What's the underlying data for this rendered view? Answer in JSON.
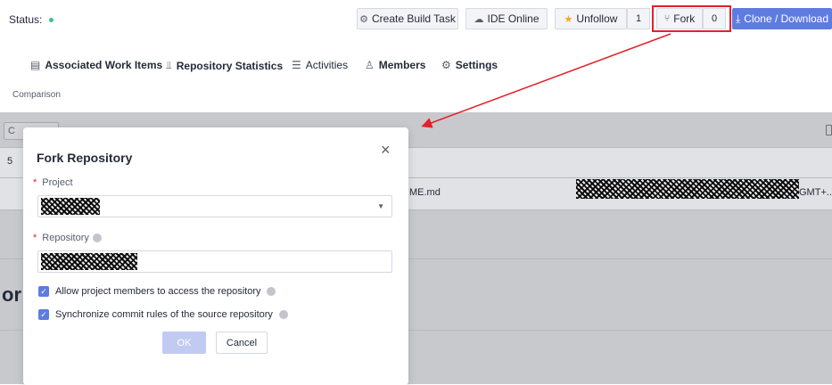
{
  "header": {
    "status_label": "Status:",
    "create_build_task": "Create Build Task",
    "ide_online": "IDE Online",
    "unfollow": "Unfollow",
    "follow_count": "1",
    "fork": "Fork",
    "fork_count": "0",
    "clone_download": "Clone / Download",
    "status_color": "#3ac295",
    "primary_color": "#5e7ce0",
    "highlight_color": "#e3202b"
  },
  "nav": {
    "tabs": [
      {
        "label": "Associated Work Items",
        "icon": "work-items-icon"
      },
      {
        "label": "Repository Statistics",
        "icon": "statistics-icon"
      },
      {
        "label": "Activities",
        "icon": "activities-icon"
      },
      {
        "label": "Members",
        "icon": "members-icon"
      },
      {
        "label": "Settings",
        "icon": "settings-icon"
      }
    ]
  },
  "background": {
    "subtitle": "Comparison",
    "button_fragment": "C",
    "row_fragment": "5",
    "file_fragment": "ME.md",
    "time_fragment": "GMT+...",
    "heading_fragment": "or"
  },
  "modal": {
    "title": "Fork Repository",
    "close_icon": "×",
    "project_label": "Project",
    "repository_label": "Repository",
    "option_members": "Allow project members to access the repository",
    "option_sync": "Synchronize commit rules of the source repository",
    "ok": "OK",
    "cancel": "Cancel"
  }
}
